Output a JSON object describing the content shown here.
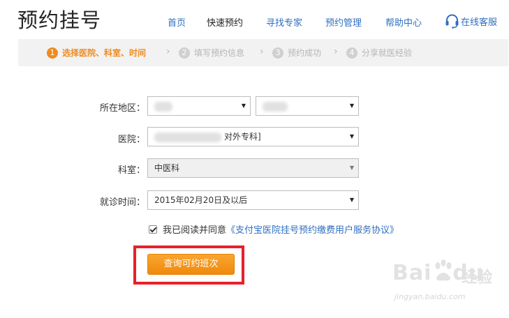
{
  "logo": "预约挂号",
  "nav": [
    {
      "label": "首页",
      "active": false
    },
    {
      "label": "快速预约",
      "active": true
    },
    {
      "label": "寻找专家",
      "active": false
    },
    {
      "label": "预约管理",
      "active": false
    },
    {
      "label": "帮助中心",
      "active": false
    }
  ],
  "service": {
    "label": "在线客服",
    "icon": "headset-icon"
  },
  "steps": [
    {
      "num": "1",
      "label": "选择医院、科室、时间",
      "active": true
    },
    {
      "num": "2",
      "label": "填写预约信息",
      "active": false
    },
    {
      "num": "3",
      "label": "预约成功",
      "active": false
    },
    {
      "num": "4",
      "label": "分享就医经验",
      "active": false
    }
  ],
  "step_separator": "›",
  "form": {
    "region_label": "所在地区：",
    "hospital_label": "医院：",
    "department_label": "科室：",
    "date_label": "就诊时间：",
    "hospital_suffix": "对外专科]",
    "department_value": "中医科",
    "date_value": "2015年02月20日及以后"
  },
  "agreement": {
    "checked": true,
    "text": "我已阅读并同意",
    "link": "《支付宝医院挂号预约缴费用户服务协议》"
  },
  "query_button": "查询可约班次",
  "watermark": {
    "brand": "Bai",
    "brand_end": "du",
    "cn": "经验",
    "url": "jingyan.baidu.com"
  },
  "colors": {
    "accent": "#ef8b1f",
    "link": "#2f6fbf",
    "highlight": "#e8202a"
  }
}
